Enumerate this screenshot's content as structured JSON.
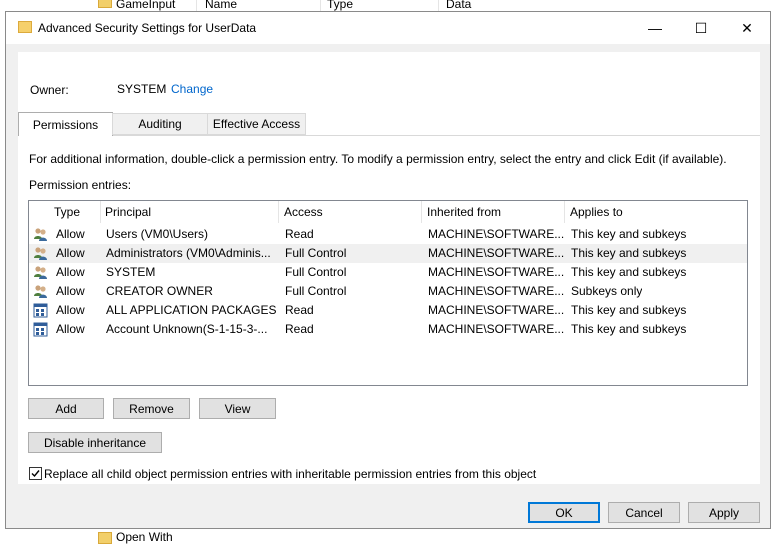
{
  "background": {
    "folder_label": "GameInput",
    "col_name": "Name",
    "col_type": "Type",
    "col_data": "Data",
    "bottom_label": "Open With"
  },
  "dialog": {
    "title": "Advanced Security Settings for UserData",
    "minimize_glyph": "—",
    "maximize_glyph": "☐",
    "close_glyph": "✕"
  },
  "owner": {
    "label": "Owner:",
    "value": "SYSTEM",
    "change_link": "Change"
  },
  "tabs": [
    {
      "label": "Permissions",
      "active": true
    },
    {
      "label": "Auditing",
      "active": false
    },
    {
      "label": "Effective Access",
      "active": false
    }
  ],
  "info_text": "For additional information, double-click a permission entry. To modify a permission entry, select the entry and click Edit (if available).",
  "entries_label": "Permission entries:",
  "table": {
    "headers": [
      "Type",
      "Principal",
      "Access",
      "Inherited from",
      "Applies to"
    ],
    "rows": [
      {
        "icon": "users-icon",
        "type": "Allow",
        "principal": "Users (VM0\\Users)",
        "access": "Read",
        "inherited": "MACHINE\\SOFTWARE...",
        "applies": "This key and subkeys",
        "selected": false
      },
      {
        "icon": "users-icon",
        "type": "Allow",
        "principal": "Administrators (VM0\\Adminis...",
        "access": "Full Control",
        "inherited": "MACHINE\\SOFTWARE...",
        "applies": "This key and subkeys",
        "selected": true
      },
      {
        "icon": "users-icon",
        "type": "Allow",
        "principal": "SYSTEM",
        "access": "Full Control",
        "inherited": "MACHINE\\SOFTWARE...",
        "applies": "This key and subkeys",
        "selected": false
      },
      {
        "icon": "users-icon",
        "type": "Allow",
        "principal": "CREATOR OWNER",
        "access": "Full Control",
        "inherited": "MACHINE\\SOFTWARE...",
        "applies": "Subkeys only",
        "selected": false
      },
      {
        "icon": "app-packages-icon",
        "type": "Allow",
        "principal": "ALL APPLICATION PACKAGES",
        "access": "Read",
        "inherited": "MACHINE\\SOFTWARE...",
        "applies": "This key and subkeys",
        "selected": false
      },
      {
        "icon": "app-packages-icon",
        "type": "Allow",
        "principal": "Account Unknown(S-1-15-3-...",
        "access": "Read",
        "inherited": "MACHINE\\SOFTWARE...",
        "applies": "This key and subkeys",
        "selected": false
      }
    ]
  },
  "buttons": {
    "add": "Add",
    "remove": "Remove",
    "view": "View",
    "disable_inheritance": "Disable inheritance",
    "ok": "OK",
    "cancel": "Cancel",
    "apply": "Apply"
  },
  "replace_checkbox": {
    "label": "Replace all child object permission entries with inheritable permission entries from this object",
    "checked": true
  },
  "colors": {
    "accent": "#0078d7",
    "link": "#0066cc",
    "dialog_bg": "#f0f0f0"
  }
}
